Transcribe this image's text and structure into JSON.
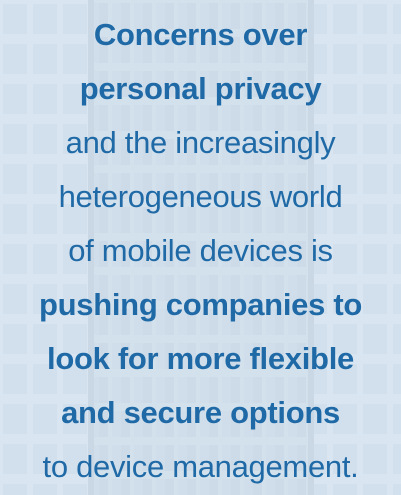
{
  "quote": {
    "lines": [
      {
        "text": "Concerns over",
        "bold": true
      },
      {
        "text": "personal privacy",
        "bold": true
      },
      {
        "text": "and the increasingly",
        "bold": false
      },
      {
        "text": "heterogeneous world",
        "bold": false
      },
      {
        "text": "of mobile devices is",
        "bold": false
      },
      {
        "text": "pushing companies to",
        "bold": true
      },
      {
        "text": "look for more flexible",
        "bold": true
      },
      {
        "text": "and secure options",
        "bold": true
      },
      {
        "text": "to device management.",
        "bold": false
      }
    ]
  },
  "colors": {
    "text": "#1f6aa6",
    "overlay": "#e8f1f9",
    "building": "#7f9cb8"
  }
}
